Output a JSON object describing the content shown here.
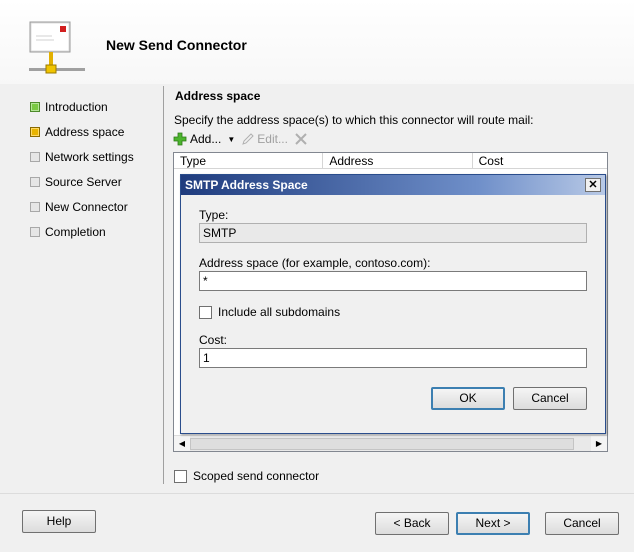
{
  "wizard": {
    "title": "New Send Connector",
    "icon": "mail-connector-icon"
  },
  "steps": [
    {
      "label": "Introduction",
      "status": "completed",
      "color": "#7ac943"
    },
    {
      "label": "Address space",
      "status": "current",
      "color": "#e8b400"
    },
    {
      "label": "Network settings",
      "status": "pending",
      "color": "#e6e6e6"
    },
    {
      "label": "Source Server",
      "status": "pending",
      "color": "#e6e6e6"
    },
    {
      "label": "New Connector",
      "status": "pending",
      "color": "#e6e6e6"
    },
    {
      "label": "Completion",
      "status": "pending",
      "color": "#e6e6e6"
    }
  ],
  "main": {
    "section_title": "Address space",
    "instruction": "Specify the address space(s) to which this connector will route mail:",
    "toolbar": {
      "add_label": "Add...",
      "edit_label": "Edit...",
      "add_icon": "green-plus-icon",
      "edit_icon": "pencil-icon",
      "remove_icon": "delete-x-icon"
    },
    "grid": {
      "columns": [
        "Type",
        "Address",
        "Cost"
      ]
    },
    "scoped_label": "Scoped send connector"
  },
  "dialog": {
    "title": "SMTP Address Space",
    "type_label": "Type:",
    "type_value": "SMTP",
    "address_label": "Address space (for example, contoso.com):",
    "address_value": "*",
    "subdomains_label": "Include all subdomains",
    "cost_label": "Cost:",
    "cost_value": "1",
    "ok_label": "OK",
    "cancel_label": "Cancel",
    "title_color": "#1f3c7e"
  },
  "footer": {
    "help_label": "Help",
    "back_label": "< Back",
    "next_label": "Next >",
    "cancel_label": "Cancel"
  }
}
